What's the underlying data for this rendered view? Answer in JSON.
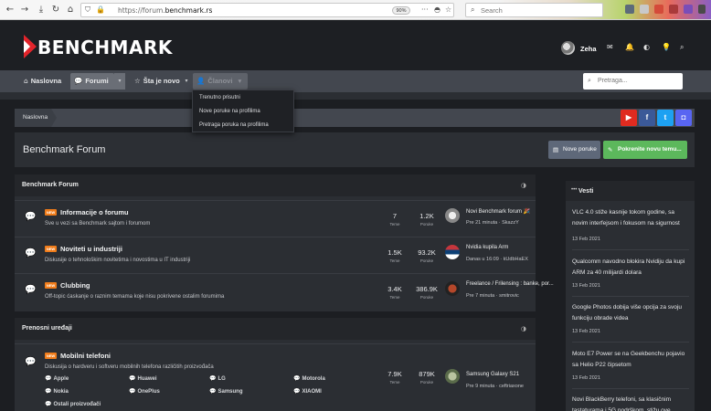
{
  "browser": {
    "url_prefix": "https://forum.",
    "url_domain": "benchmark.rs",
    "zoom": "90%",
    "search_placeholder": "Search"
  },
  "header": {
    "logo_text": "BENCHMARK",
    "username": "Zeha"
  },
  "nav": {
    "items": [
      "Naslovna",
      "Forumi",
      "Šta je novo",
      "Članovi"
    ],
    "search_placeholder": "Pretraga..."
  },
  "dropdown": {
    "items": [
      "Trenutno prisutni",
      "Nove poruke na profilima",
      "Pretraga poruka na profilima"
    ]
  },
  "breadcrumb": {
    "items": [
      "Naslovna"
    ]
  },
  "page": {
    "title": "Benchmark Forum",
    "new_posts_label": "Nove poruke",
    "new_thread_label": "Pokrenite novu temu..."
  },
  "blocks": [
    {
      "title": "Benchmark Forum",
      "nodes": [
        {
          "badge": "NEW",
          "title": "Informacije o forumu",
          "desc": "Sve u vezi sa Benchmark sajtom i forumom",
          "threads": "7",
          "threads_label": "Teme",
          "posts": "1.2K",
          "posts_label": "Poruke",
          "last_title": "Novi Benchmark forum 🎉",
          "last_meta": "Pre 21 minuta · SkazzY"
        },
        {
          "badge": "NEW",
          "title": "Noviteti u industriji",
          "desc": "Diskusije o tehnološkim novitetima i novostima u IT industriji",
          "threads": "1.5K",
          "threads_label": "Teme",
          "posts": "93.2K",
          "posts_label": "Poruke",
          "last_title": "Nvidia kupila Arm",
          "last_meta": "Danas u 16:09 · kUdbHaEX"
        },
        {
          "badge": "NEW",
          "title": "Clubbing",
          "desc": "Off-topic ćaskanje o raznim temama koje nisu pokrivene ostalim forumima",
          "threads": "3.4K",
          "threads_label": "Teme",
          "posts": "386.9K",
          "posts_label": "Poruke",
          "last_title": "Freelance / Frilensing : banke, por...",
          "last_meta": "Pre 7 minuta · smitrovic"
        }
      ]
    },
    {
      "title": "Prenosni uređaji",
      "nodes": [
        {
          "badge": "NEW",
          "title": "Mobilni telefoni",
          "desc": "Diskusija o hardveru i softveru mobilnih telefona različitih proizvođača",
          "threads": "7.9K",
          "threads_label": "Teme",
          "posts": "879K",
          "posts_label": "Poruke",
          "last_title": "Samsung Galaxy S21",
          "last_meta": "Pre 9 minuta · ceftriaxone",
          "subforums": [
            "Apple",
            "Huawei",
            "LG",
            "Motorola",
            "Nokia",
            "OnePlus",
            "Samsung",
            "XIAOMI",
            "Ostali proizvođači"
          ]
        }
      ]
    }
  ],
  "sidebar": {
    "title": "Vesti",
    "news": [
      {
        "title": "VLC 4.0 stiže kasnije tokom godine, sa novim interfejsom i fokusom na sigurnost",
        "date": "13 Feb 2021"
      },
      {
        "title": "Qualcomm navodno blokira Nvidiju da kupi ARM za 40 milijardi dolara",
        "date": "13 Feb 2021"
      },
      {
        "title": "Google Photos dobija više opcija za svoju funkciju obrade videa",
        "date": "13 Feb 2021"
      },
      {
        "title": "Moto E7 Power se na Geekbenchu pojavio sa Helio P22 čipsetom",
        "date": "13 Feb 2021"
      },
      {
        "title": "Novi BlackBerry telefoni, sa klasičnim tastaturama i 5G podrškom, stižu ove godine",
        "date": ""
      }
    ]
  },
  "colors": {
    "accent_red": "#e3242b",
    "new_badge": "#f07c1a",
    "button_green": "#5cb85c",
    "button_grey": "#5e6879"
  }
}
